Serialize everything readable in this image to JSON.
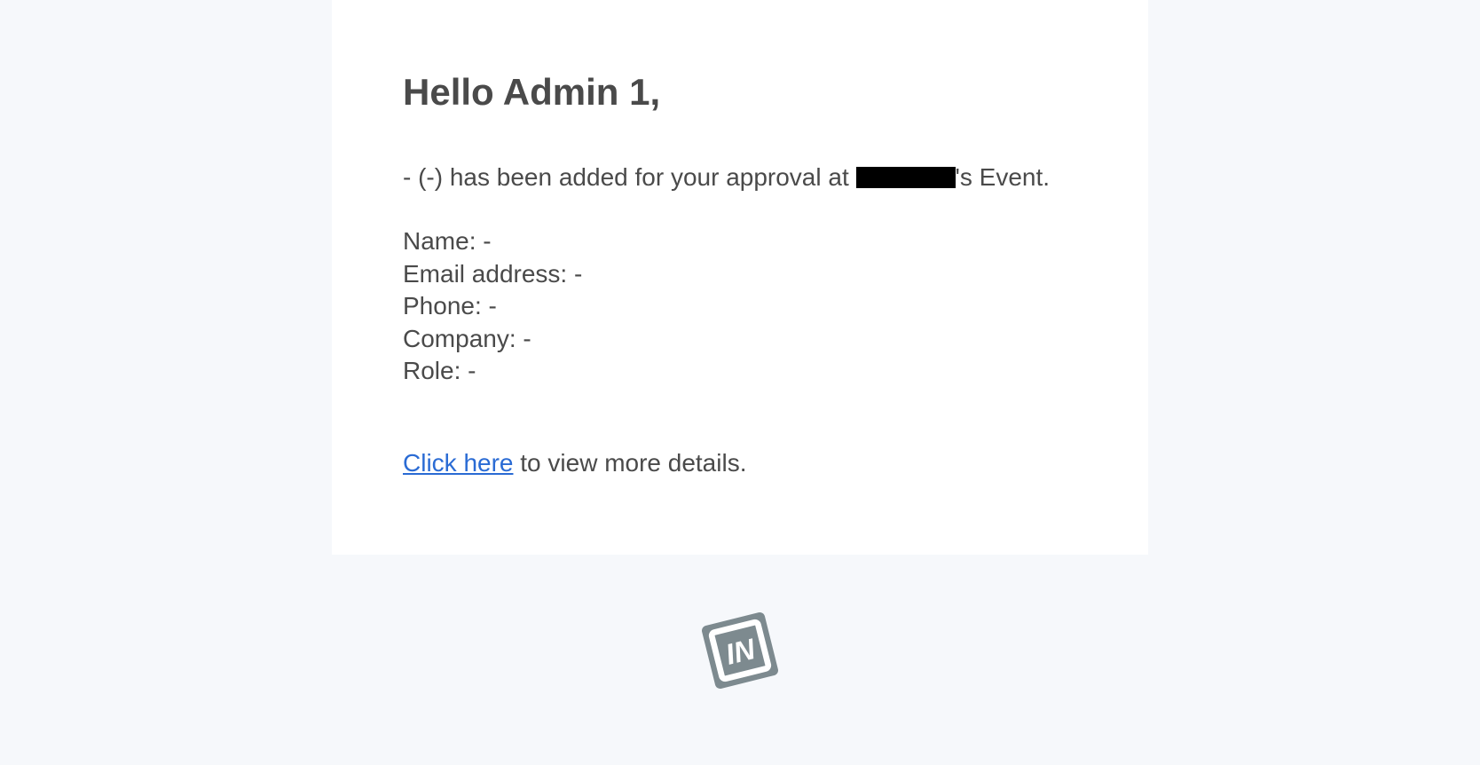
{
  "greeting": "Hello Admin 1,",
  "approval_line_prefix": "- (-) has been added for your approval at ",
  "approval_line_suffix": "'s Event.",
  "fields": {
    "name_label": "Name: ",
    "name_value": "-",
    "email_label": "Email address: ",
    "email_value": "-",
    "phone_label": "Phone: ",
    "phone_value": "-",
    "company_label": "Company: ",
    "company_value": "-",
    "role_label": "Role: ",
    "role_value": "-"
  },
  "cta": {
    "link_text": "Click here",
    "suffix": " to view more details."
  }
}
